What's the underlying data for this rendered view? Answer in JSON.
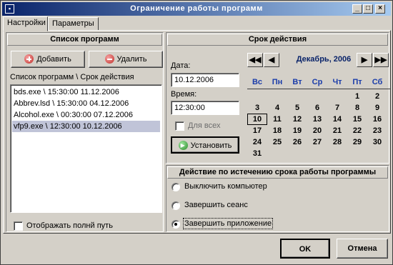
{
  "window": {
    "title": "Ограничение работы программ"
  },
  "tabs": [
    {
      "label": "Настройки"
    },
    {
      "label": "Параметры"
    }
  ],
  "programs": {
    "header": "Список программ",
    "add_label": "Добавить",
    "remove_label": "Удалить",
    "list_caption": "Список программ \\ Срок действия",
    "items": [
      {
        "text": "bds.exe \\ 15:30:00 11.12.2006"
      },
      {
        "text": "Abbrev.lsd \\ 15:30:00 04.12.2006"
      },
      {
        "text": "Alcohol.exe \\ 00:30:00 07.12.2006"
      },
      {
        "text": "vfp9.exe \\ 12:30:00 10.12.2006"
      }
    ],
    "selected_index": 3,
    "full_path_label": "Отображать полнй путь"
  },
  "validity": {
    "header": "Срок действия",
    "date_label": "Дата:",
    "date_value": "10.12.2006",
    "time_label": "Время:",
    "time_value": "12:30:00",
    "all_label": "Для всех",
    "set_label": "Установить"
  },
  "calendar": {
    "month_label": "Декабрь, 2006",
    "prev_year": "◀◀",
    "prev_month": "◀",
    "next_month": "▶",
    "next_year": "▶▶",
    "weekdays": [
      "Вс",
      "Пн",
      "Вт",
      "Ср",
      "Чт",
      "Пт",
      "Сб"
    ],
    "weeks": [
      [
        "",
        "",
        "",
        "",
        "",
        "1",
        "2"
      ],
      [
        "3",
        "4",
        "5",
        "6",
        "7",
        "8",
        "9"
      ],
      [
        "10",
        "11",
        "12",
        "13",
        "14",
        "15",
        "16"
      ],
      [
        "17",
        "18",
        "19",
        "20",
        "21",
        "22",
        "23"
      ],
      [
        "24",
        "25",
        "26",
        "27",
        "28",
        "29",
        "30"
      ],
      [
        "31",
        "",
        "",
        "",
        "",
        "",
        ""
      ]
    ],
    "today": "10"
  },
  "action": {
    "header": "Действие по истечению срока работы программы",
    "options": [
      {
        "label": "Выключить компьютер"
      },
      {
        "label": "Завершить сеанс"
      },
      {
        "label": "Завершить приложение"
      }
    ],
    "selected_index": 2
  },
  "footer": {
    "ok_label": "OK",
    "cancel_label": "Отмена"
  },
  "colors": {
    "titlebar_start": "#0a246a",
    "titlebar_end": "#a6caf0",
    "face": "#d4d0c8",
    "calendar_text": "#1a3caa"
  }
}
